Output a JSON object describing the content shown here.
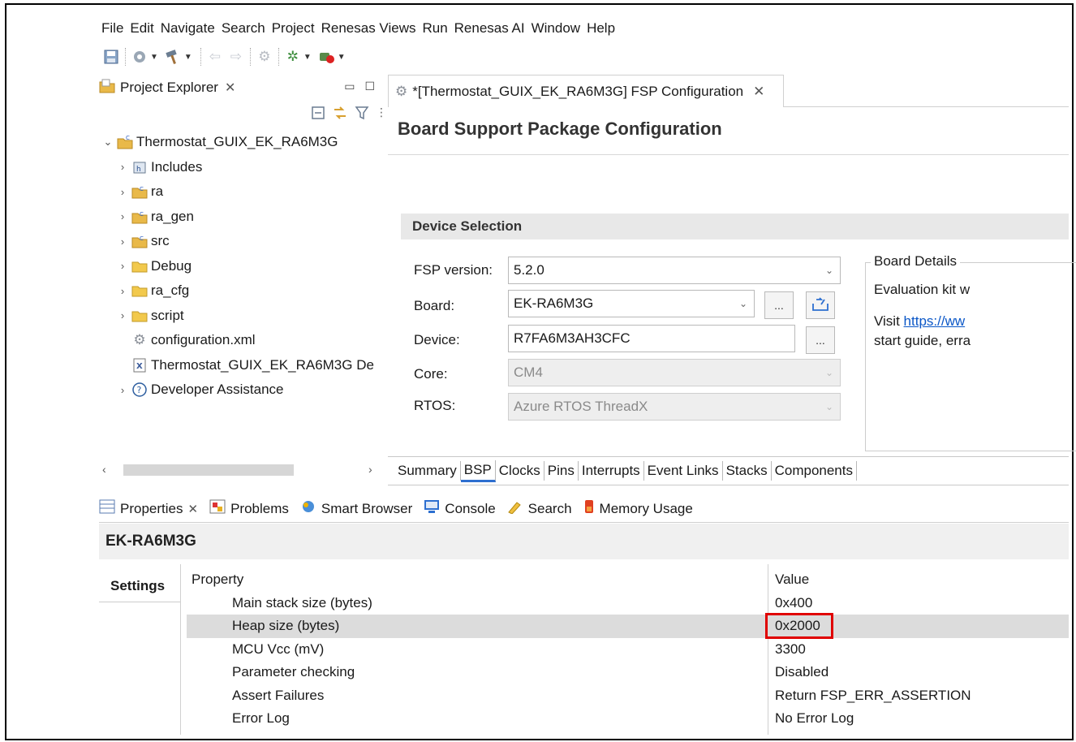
{
  "menu": [
    "File",
    "Edit",
    "Navigate",
    "Search",
    "Project",
    "Renesas Views",
    "Run",
    "Renesas AI",
    "Window",
    "Help"
  ],
  "project_explorer": {
    "title": "Project Explorer",
    "tree": [
      {
        "label": "Thermostat_GUIX_EK_RA6M3G",
        "icon": "project-icon",
        "expanded": true,
        "level": 0
      },
      {
        "label": "Includes",
        "icon": "includes-icon",
        "level": 1
      },
      {
        "label": "ra",
        "icon": "source-folder-icon",
        "level": 1
      },
      {
        "label": "ra_gen",
        "icon": "source-folder-icon",
        "level": 1
      },
      {
        "label": "src",
        "icon": "source-folder-icon",
        "level": 1
      },
      {
        "label": "Debug",
        "icon": "folder-icon",
        "level": 1
      },
      {
        "label": "ra_cfg",
        "icon": "folder-icon",
        "level": 1
      },
      {
        "label": "script",
        "icon": "folder-icon",
        "level": 1
      },
      {
        "label": "configuration.xml",
        "icon": "config-file-icon",
        "level": 1,
        "leaf": true
      },
      {
        "label": "Thermostat_GUIX_EK_RA6M3G De",
        "icon": "xml-file-icon",
        "level": 1,
        "leaf": true
      },
      {
        "label": "Developer Assistance",
        "icon": "help-icon",
        "level": 1
      }
    ]
  },
  "editor": {
    "tab_title": "*[Thermostat_GUIX_EK_RA6M3G] FSP Configuration",
    "heading": "Board Support Package Configuration",
    "device_selection": {
      "section_title": "Device Selection",
      "fsp_version_label": "FSP version:",
      "fsp_version_value": "5.2.0",
      "board_label": "Board:",
      "board_value": "EK-RA6M3G",
      "device_label": "Device:",
      "device_value": "R7FA6M3AH3CFC",
      "core_label": "Core:",
      "core_value": "CM4",
      "rtos_label": "RTOS:",
      "rtos_value": "Azure RTOS ThreadX",
      "browse_label": "..."
    },
    "board_details": {
      "title": "Board Details",
      "line1": "Evaluation kit w",
      "line2_prefix": "Visit ",
      "line2_link": "https://ww",
      "line3": "start guide, erra"
    },
    "bottom_tabs": [
      "Summary",
      "BSP",
      "Clocks",
      "Pins",
      "Interrupts",
      "Event Links",
      "Stacks",
      "Components"
    ],
    "active_bottom_tab": "BSP"
  },
  "properties": {
    "tabs": [
      {
        "label": "Properties",
        "icon": "properties-icon"
      },
      {
        "label": "Problems",
        "icon": "problems-icon"
      },
      {
        "label": "Smart Browser",
        "icon": "smart-browser-icon"
      },
      {
        "label": "Console",
        "icon": "console-icon"
      },
      {
        "label": "Search",
        "icon": "search-icon"
      },
      {
        "label": "Memory Usage",
        "icon": "memory-usage-icon"
      }
    ],
    "title": "EK-RA6M3G",
    "settings_tab": "Settings",
    "header_property": "Property",
    "header_value": "Value",
    "rows": [
      {
        "name": "Main stack size (bytes)",
        "value": "0x400"
      },
      {
        "name": "Heap size (bytes)",
        "value": "0x2000",
        "highlighted": true
      },
      {
        "name": "MCU Vcc (mV)",
        "value": "3300"
      },
      {
        "name": "Parameter checking",
        "value": "Disabled"
      },
      {
        "name": "Assert Failures",
        "value": "Return FSP_ERR_ASSERTION"
      },
      {
        "name": "Error Log",
        "value": "No Error Log"
      }
    ]
  },
  "colors": {
    "link": "#0b57c7",
    "highlight_box": "#e00000",
    "active_tab_underline": "#2d6fd0"
  }
}
